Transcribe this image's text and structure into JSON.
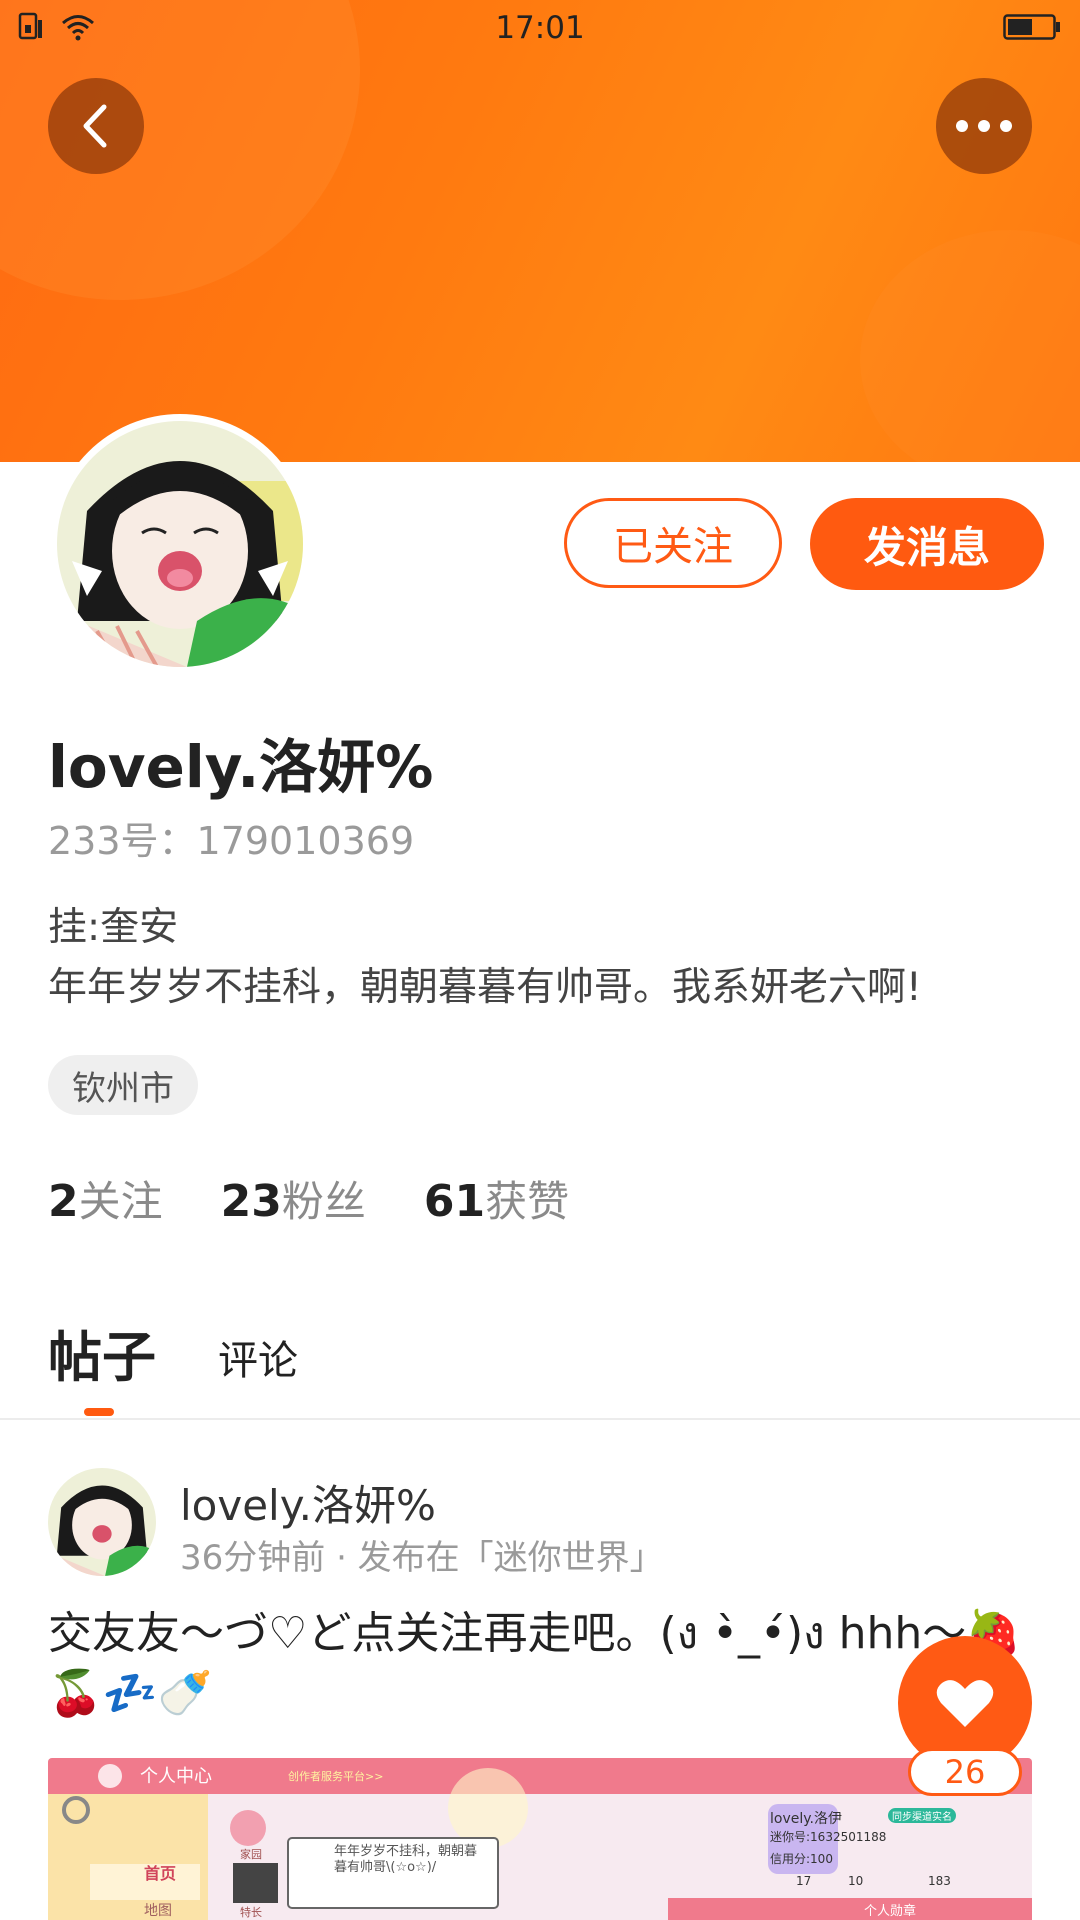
{
  "status_bar": {
    "time": "17:01"
  },
  "profile": {
    "name": "lovely.洛妍%",
    "id_text": "233号：179010369",
    "bio_line1": "挂:奎安",
    "bio_line2": "年年岁岁不挂科，朝朝暮暮有帅哥。我系妍老六啊!",
    "location": "钦州市",
    "follow_button_label": "已关注",
    "message_button_label": "发消息"
  },
  "stats": {
    "following_count": "2",
    "following_label": "关注",
    "fans_count": "23",
    "fans_label": "粉丝",
    "likes_count": "61",
    "likes_label": "获赞"
  },
  "tabs": {
    "posts": "帖子",
    "comments": "评论"
  },
  "post": {
    "author": "lovely.洛妍%",
    "meta": "36分钟前 · 发布在「迷你世界」",
    "text": "交友友～づ♡ど点关注再走吧。(ง •̀_•́)ง hhh～🍓🍒💤🍼",
    "like_count": "26",
    "image": {
      "header_title": "个人中心",
      "header_link": "创作者服务平台>>",
      "menu_home": "首页",
      "menu_map": "地图",
      "bubble_text": "年年岁岁不挂科，朝朝暮暮有帅哥\\(☆o☆)/",
      "game_name": "lovely.洛伊",
      "game_id": "迷你号:1632501188",
      "credit": "信用分:100",
      "badge_text": "个人勋章",
      "sync_label": "同步渠道实名",
      "num1": "17",
      "num2": "10",
      "num3": "183",
      "home_icon_label": "家园",
      "special_label": "特长"
    }
  },
  "colors": {
    "accent": "#ff5a10",
    "header": "#ff7a10"
  }
}
